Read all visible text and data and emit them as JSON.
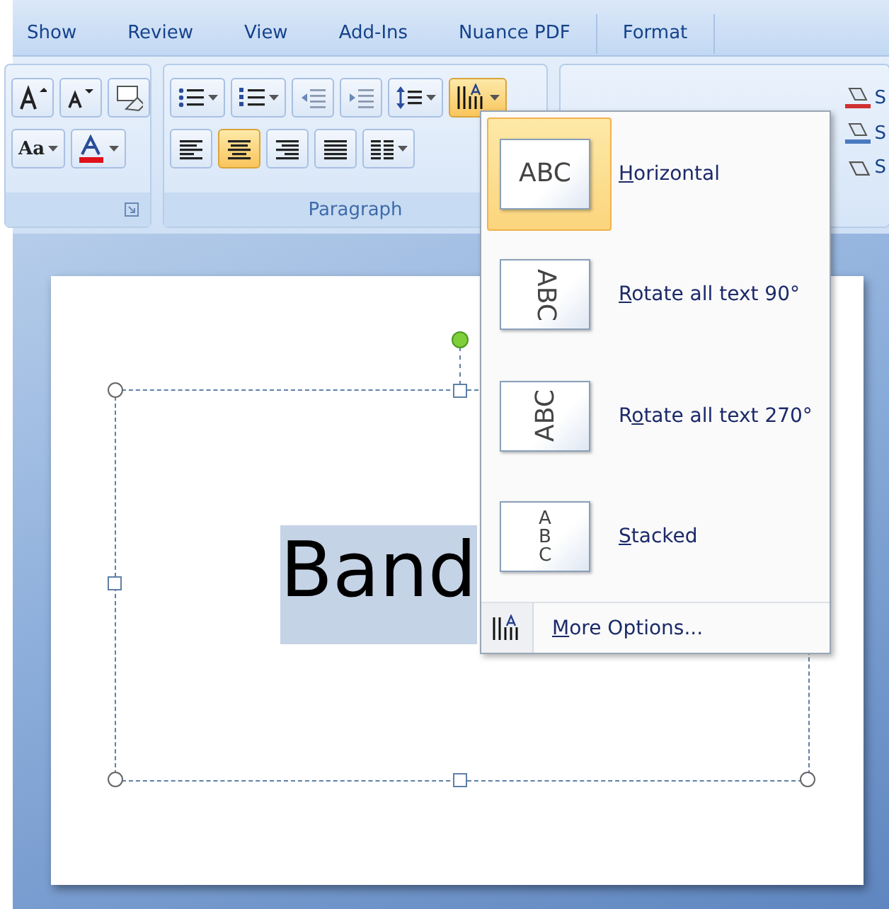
{
  "ribbon_tabs": [
    "Show",
    "Review",
    "View",
    "Add-Ins",
    "Nuance PDF",
    "Format"
  ],
  "font_group": {
    "row1": [
      {
        "kind": "grow-font",
        "on": false
      },
      {
        "kind": "shrink-font",
        "on": false
      },
      {
        "kind": "clear-format",
        "on": false
      }
    ],
    "row2": [
      {
        "kind": "change-case",
        "label": "Aa",
        "on": false
      },
      {
        "kind": "font-color",
        "on": false
      }
    ]
  },
  "paragraph_group": {
    "label": "Paragraph",
    "row1": [
      {
        "kind": "bullets",
        "on": false
      },
      {
        "kind": "numbering",
        "on": false
      },
      {
        "kind": "outdent",
        "on": false
      },
      {
        "kind": "indent",
        "on": false
      },
      {
        "kind": "line-spacing",
        "on": false
      },
      {
        "kind": "text-direction",
        "on": true
      }
    ],
    "row2": [
      {
        "kind": "align-left",
        "on": false
      },
      {
        "kind": "align-center",
        "on": true
      },
      {
        "kind": "align-right",
        "on": false
      },
      {
        "kind": "justify",
        "on": false
      },
      {
        "kind": "columns",
        "on": false
      }
    ]
  },
  "drawing_group": {
    "commands": [
      {
        "kind": "fill",
        "label": "S"
      },
      {
        "kind": "outline",
        "label": "S"
      },
      {
        "kind": "effects",
        "label": "S"
      }
    ]
  },
  "text_direction_menu": {
    "items": [
      {
        "kind": "horizontal",
        "preview": "ABC",
        "key": "H",
        "after": "orizontal",
        "selected": true
      },
      {
        "kind": "rotate90",
        "preview": "ABC",
        "key": "R",
        "after": "otate all text 90°",
        "selected": false
      },
      {
        "kind": "rotate270",
        "preview": "ABC",
        "before": "R",
        "key": "o",
        "after": "tate all text 270°",
        "selected": false
      },
      {
        "kind": "stacked",
        "preview": "ABC",
        "key": "S",
        "after": "tacked",
        "selected": false
      }
    ],
    "footer": {
      "key": "M",
      "after": "ore Options..."
    }
  },
  "slide": {
    "text": "Band",
    "text_selected": true
  }
}
